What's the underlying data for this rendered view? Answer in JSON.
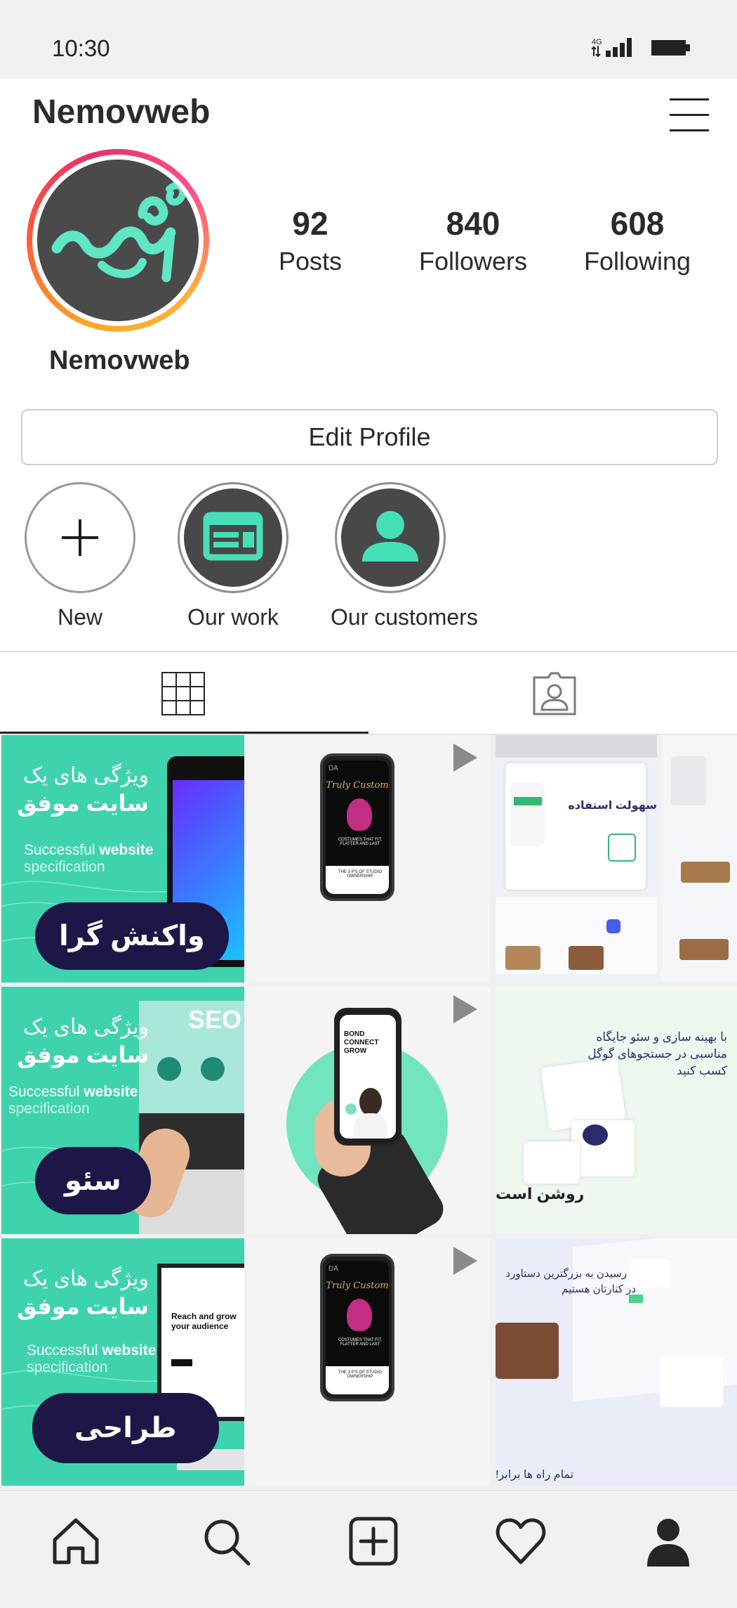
{
  "status": {
    "time": "10:30",
    "network": "4G"
  },
  "header": {
    "username": "Nemovweb"
  },
  "profile": {
    "display_name": "Nemovweb",
    "stats": [
      {
        "value": "92",
        "label": "Posts"
      },
      {
        "value": "840",
        "label": "Followers"
      },
      {
        "value": "608",
        "label": "Following"
      }
    ],
    "edit_button": "Edit Profile"
  },
  "highlights": [
    {
      "label": "New",
      "icon": "plus-icon"
    },
    {
      "label": "Our work",
      "icon": "layout-icon"
    },
    {
      "label": "Our customers",
      "icon": "user-icon"
    }
  ],
  "tabs": [
    {
      "name": "grid",
      "icon": "grid-icon",
      "active": true
    },
    {
      "name": "tagged",
      "icon": "tagged-person-icon",
      "active": false
    }
  ],
  "posts": [
    {
      "title": "ویژگی های یک",
      "subtitle": "سایت موفق",
      "line1_pre": "Successful ",
      "line1_bold": "website",
      "line2": "specification",
      "pill": "واکنش گرا"
    },
    {
      "title": "ویژگی های یک",
      "subtitle": "سایت موفق",
      "line1_pre": "Successful ",
      "line1_bold": "website",
      "line2": "specification",
      "pill": "سئو",
      "screen": "SEO"
    },
    {
      "title": "ویژگی های یک",
      "subtitle": "سایت موفق",
      "line1_pre": "Successful ",
      "line1_bold": "website",
      "line2": "specification",
      "pill": "طراحی",
      "screen_title": "Reach and grow your audience"
    }
  ],
  "video_posts": [
    {
      "brand": "DA",
      "heading": "Truly Custom",
      "caption": "COSTUMES THAT FIT, FLATTER AND LAST",
      "footer": "THE 3 P'S OF STUDIO OWNERSHIP"
    },
    {
      "heading": "BOND CONNECT GROW"
    },
    {
      "brand": "DA",
      "heading": "Truly Custom",
      "caption": "COSTUMES THAT FIT, FLATTER AND LAST",
      "footer": "THE 3 P'S OF STUDIO OWNERSHIP"
    }
  ],
  "mockups": [
    {
      "heading": "سهولت استفاده"
    },
    {
      "heading": "با بهینه سازی و سئو جایگاه مناسبی در جستجوهای گوگل کسب کنید",
      "footer": "روشن است"
    },
    {
      "heading": "تا رسیدن به بزرگترین دستاورد در کنارتان هستیم",
      "footer": "تمام راه ها برابر!"
    }
  ],
  "bottom_nav": [
    "home-icon",
    "search-icon",
    "add-post-icon",
    "heart-icon",
    "profile-icon"
  ],
  "colors": {
    "accent_mint": "#3fd3ad",
    "dark_navy": "#1c1747",
    "avatar_bg": "#4a4a4a"
  }
}
